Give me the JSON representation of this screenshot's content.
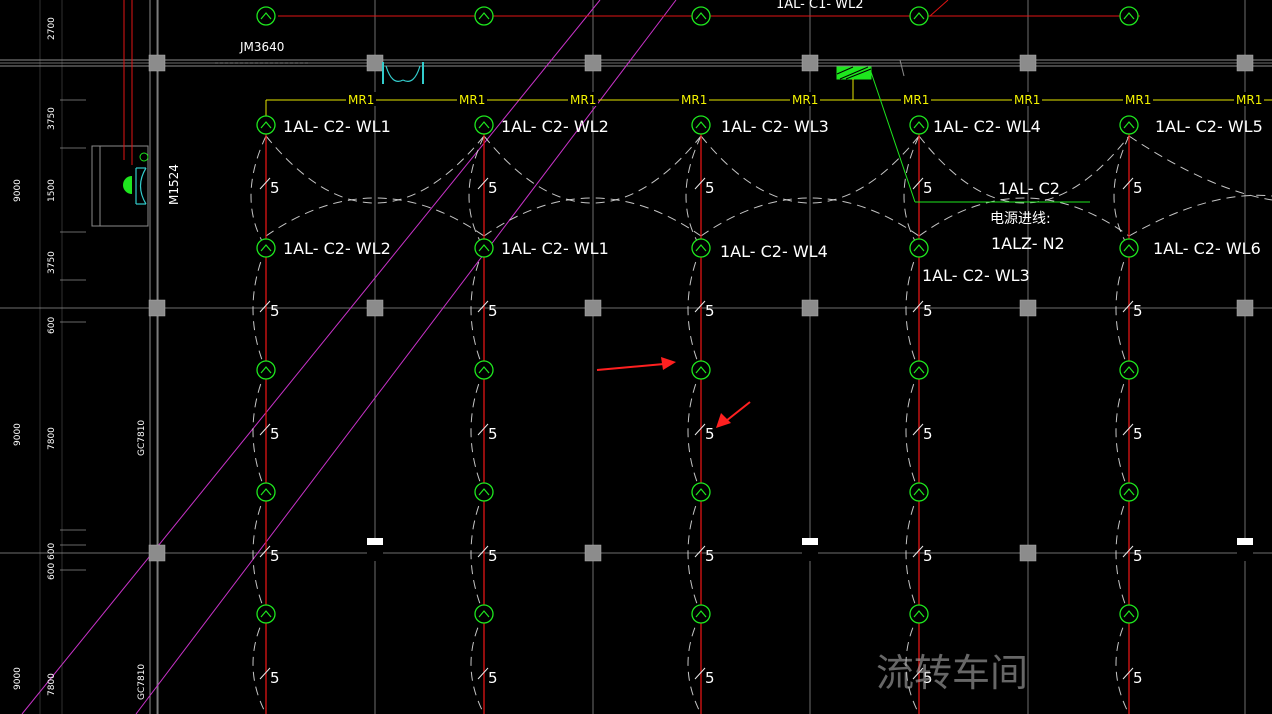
{
  "drawing": {
    "colors": {
      "background": "#000000",
      "grid": "#8a8a8a",
      "circuit": "#e01414",
      "fixture": "#1ee61e",
      "mr_line": "#e6e600",
      "diagonal": "#c832c8",
      "column": "#8c8c8c",
      "arrow": "#ff2020",
      "leader": "#1ee61e",
      "door": "#33cccc",
      "dashed_curve": "#e8e8e8",
      "watermark": "#bbbbbb"
    },
    "top_label": "1AL- C1- WL2",
    "window_label": "JM3640",
    "door_label": "M1524",
    "column_tag_1": "GC7810",
    "column_tag_2": "GC7810",
    "mr_label": "MR1",
    "wire_count": "5",
    "row1_labels": [
      "1AL- C2- WL1",
      "1AL- C2- WL2",
      "1AL- C2- WL3",
      "1AL- C2- WL4",
      "1AL- C2- WL5"
    ],
    "row2_labels": [
      "1AL- C2- WL2",
      "1AL- C2- WL1",
      "1AL- C2- WL4",
      "1AL- C2- WL3",
      "1AL- C2- WL6"
    ],
    "panel": {
      "name": "1AL- C2",
      "source_caption": "电源进线:",
      "source": "1ALZ- N2"
    },
    "watermark": "流转车间",
    "dimensions_left": {
      "col_a": [
        "2700",
        "9000",
        "9000",
        "9000"
      ],
      "col_b": [
        "3750",
        "1500",
        "3750",
        "600",
        "7800",
        "600",
        "600",
        "7800"
      ]
    }
  }
}
